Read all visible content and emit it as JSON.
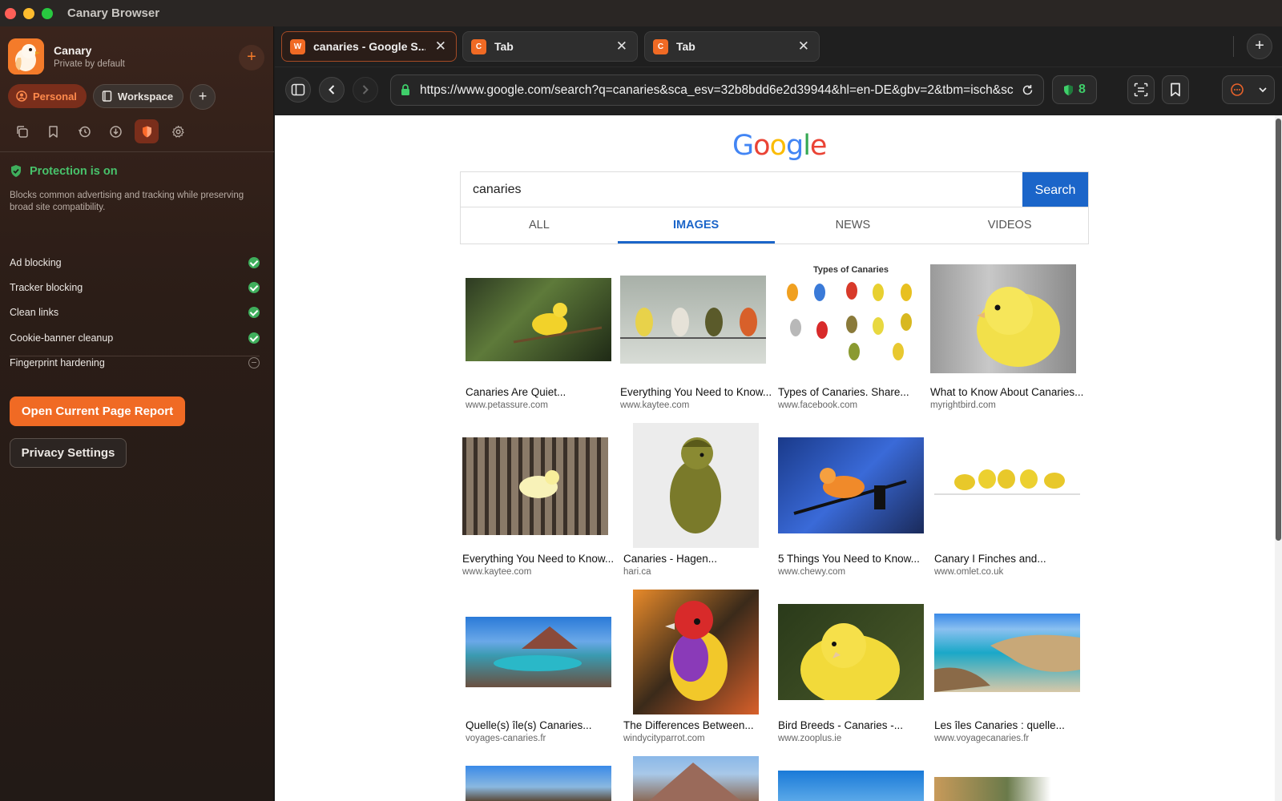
{
  "window": {
    "title": "Canary Browser"
  },
  "sidebar": {
    "profile_name": "Canary",
    "profile_subtitle": "Private by default",
    "spaces": [
      {
        "label": "Personal"
      },
      {
        "label": "Workspace"
      }
    ],
    "protection": {
      "title": "Protection is on",
      "description": "Blocks common advertising and tracking while preserving broad site compatibility.",
      "features": [
        {
          "label": "Ad blocking",
          "enabled": true
        },
        {
          "label": "Tracker blocking",
          "enabled": true
        },
        {
          "label": "Clean links",
          "enabled": true
        },
        {
          "label": "Cookie-banner cleanup",
          "enabled": true
        },
        {
          "label": "Fingerprint hardening",
          "enabled": false
        }
      ]
    },
    "report_button": "Open Current Page Report",
    "privacy_button": "Privacy Settings"
  },
  "tabs": [
    {
      "favicon": "W",
      "title": "canaries - Google S...",
      "active": true
    },
    {
      "favicon": "C",
      "title": "Tab",
      "active": false
    },
    {
      "favicon": "C",
      "title": "Tab",
      "active": false
    }
  ],
  "navbar": {
    "url": "https://www.google.com/search?q=canaries&sca_esv=32b8bdd6e2d39944&hl=en-DE&gbv=2&tbm=isch&sc",
    "shield_count": "8"
  },
  "google": {
    "query": "canaries",
    "search_button": "Search",
    "tabs": [
      "ALL",
      "IMAGES",
      "NEWS",
      "VIDEOS"
    ],
    "selected_tab": "IMAGES",
    "results": [
      {
        "title": "Canaries Are Quiet...",
        "source": "www.petassure.com"
      },
      {
        "title": "Everything You Need to Know...",
        "source": "www.kaytee.com"
      },
      {
        "title": "Types of Canaries. Share...",
        "source": "www.facebook.com",
        "image_caption": "Types of Canaries"
      },
      {
        "title": "What to Know About Canaries...",
        "source": "myrightbird.com"
      },
      {
        "title": "Everything You Need to Know...",
        "source": "www.kaytee.com"
      },
      {
        "title": "Canaries - Hagen...",
        "source": "hari.ca"
      },
      {
        "title": "5 Things You Need to Know...",
        "source": "www.chewy.com"
      },
      {
        "title": "Canary I Finches and...",
        "source": "www.omlet.co.uk"
      },
      {
        "title": "Quelle(s) île(s) Canaries...",
        "source": "voyages-canaries.fr"
      },
      {
        "title": "The Differences Between...",
        "source": "windycityparrot.com"
      },
      {
        "title": "Bird Breeds - Canaries -...",
        "source": "www.zooplus.ie"
      },
      {
        "title": "Les îles Canaries : quelle...",
        "source": "www.voyagecanaries.fr"
      }
    ]
  },
  "colors": {
    "accent": "#f06a24",
    "protection_green": "#48c26b",
    "google_blue": "#1b65c9"
  }
}
